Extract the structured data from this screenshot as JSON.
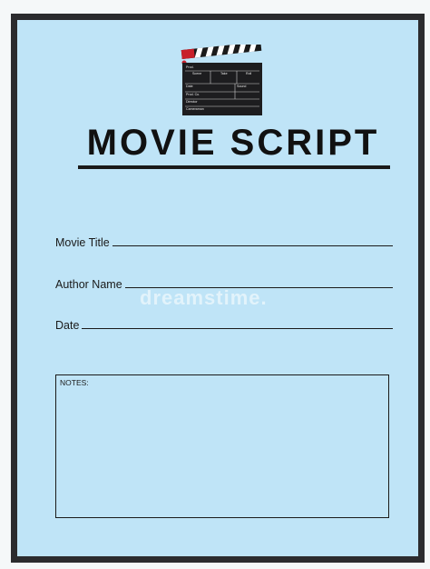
{
  "document": {
    "title": "MOVIE SCRIPT",
    "fields": {
      "movie_title_label": "Movie Title",
      "author_name_label": "Author Name",
      "date_label": "Date"
    },
    "notes_label": "NOTES:",
    "watermark": "dreamstime.",
    "clapperboard": {
      "icon": "clapperboard-icon",
      "labels": {
        "prod": "Prod.",
        "scene": "Scene",
        "take": "Take",
        "roll": "Roll",
        "date": "Date",
        "sound": "Sound",
        "prod_co": "Prod. Co.",
        "director": "Director",
        "cameraman": "Cameraman"
      }
    }
  },
  "colors": {
    "background": "#bfe4f7",
    "border": "#2b2b2e",
    "text": "#111111",
    "clapper_red": "#c8202a"
  }
}
